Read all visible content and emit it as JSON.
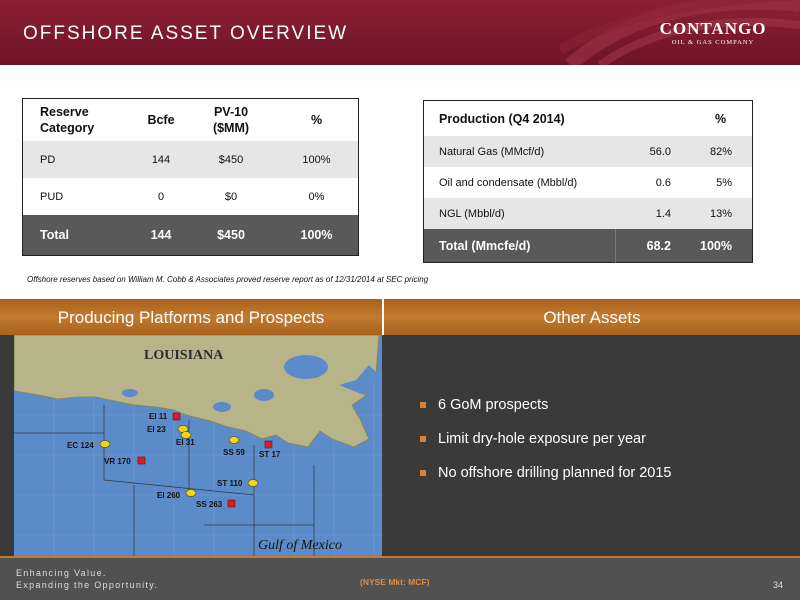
{
  "header": {
    "title": "OFFSHORE ASSET OVERVIEW",
    "logo_name": "CONTANGO",
    "logo_sub": "OIL & GAS COMPANY"
  },
  "colors": {
    "maroon": "#7a1a2c",
    "gold": "#c27a2f",
    "dark_panel": "#3a3a3a",
    "table_total": "#595959",
    "map_water": "#5b8bc9",
    "map_land": "#b8b48a"
  },
  "reserve_table": {
    "headers": [
      "Reserve Category",
      "Bcfe",
      "PV-10 ($MM)",
      "%"
    ],
    "rows": [
      [
        "PD",
        "144",
        "$450",
        "100%"
      ],
      [
        "PUD",
        "0",
        "$0",
        "0%"
      ]
    ],
    "total": [
      "Total",
      "144",
      "$450",
      "100%"
    ]
  },
  "production_table": {
    "headers": [
      "Production (Q4 2014)",
      "",
      "%"
    ],
    "rows": [
      [
        "Natural Gas (MMcf/d)",
        "56.0",
        "82%"
      ],
      [
        "Oil and condensate (Mbbl/d)",
        "0.6",
        "5%"
      ],
      [
        "NGL (Mbbl/d)",
        "1.4",
        "13%"
      ]
    ],
    "total": [
      "Total (Mmcfe/d)",
      "68.2",
      "100%"
    ]
  },
  "footnote": "Offshore reserves based on William M. Cobb & Associates proved reserve report as of 12/31/2014 at SEC pricing",
  "sections": {
    "left_title": "Producing Platforms and Prospects",
    "right_title": "Other Assets"
  },
  "map": {
    "state_label": "LOUISIANA",
    "water_label": "Gulf of Mexico",
    "markers": [
      {
        "label": "EI 11",
        "type": "platform"
      },
      {
        "label": "EI 23",
        "type": "prospect"
      },
      {
        "label": "EI 31",
        "type": "prospect"
      },
      {
        "label": "SS 59",
        "type": "prospect"
      },
      {
        "label": "ST 17",
        "type": "platform"
      },
      {
        "label": "EC 124",
        "type": "prospect"
      },
      {
        "label": "VR 170",
        "type": "platform"
      },
      {
        "label": "ST 110",
        "type": "prospect"
      },
      {
        "label": "EI 260",
        "type": "prospect"
      },
      {
        "label": "SS 263",
        "type": "platform"
      }
    ]
  },
  "other_assets": [
    "6 GoM prospects",
    "Limit dry-hole exposure per year",
    "No offshore drilling planned for 2015"
  ],
  "footer": {
    "tagline_1": "Enhancing Value.",
    "tagline_2": "Expanding the Opportunity.",
    "ticker": "(NYSE Mkt: MCF)",
    "page_number": "34"
  }
}
